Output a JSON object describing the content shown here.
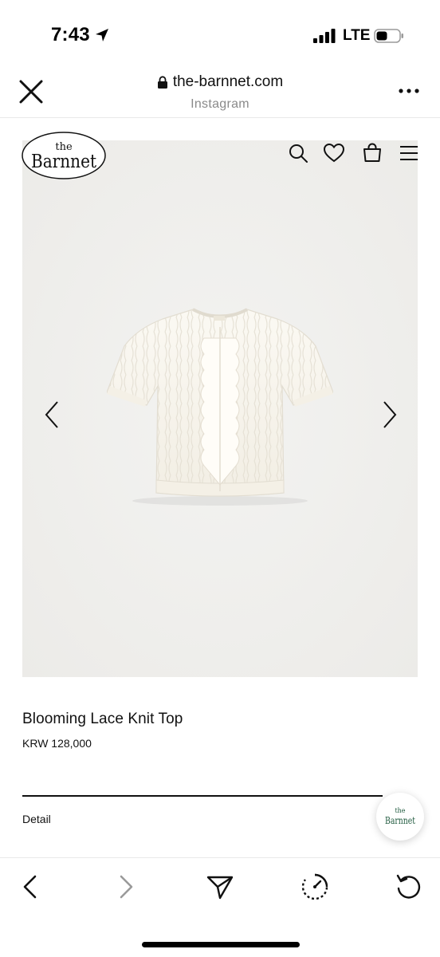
{
  "status_bar": {
    "time": "7:43",
    "network": "LTE",
    "icons": [
      "location-arrow-icon",
      "signal-icon",
      "battery-icon"
    ]
  },
  "browser": {
    "url": "the-barnnet.com",
    "source": "Instagram",
    "icons": [
      "close-icon",
      "lock-icon",
      "more-icon"
    ]
  },
  "site": {
    "logo_small": "the",
    "logo_main": "Barnnet",
    "nav_icons": [
      "search-icon",
      "heart-icon",
      "shopping-bag-icon",
      "menu-icon"
    ]
  },
  "product": {
    "title": "Blooming Lace Knit Top",
    "price": "KRW 128,000",
    "detail_label": "Detail",
    "image_icons": [
      "chevron-left-icon",
      "chevron-right-icon"
    ]
  },
  "floating_badge": {
    "small": "the",
    "main": "Barnnet",
    "accent": "#1f5a3e"
  },
  "toolbar": {
    "icons": [
      "back-icon",
      "forward-icon",
      "share-icon",
      "speed-icon",
      "refresh-icon"
    ]
  }
}
